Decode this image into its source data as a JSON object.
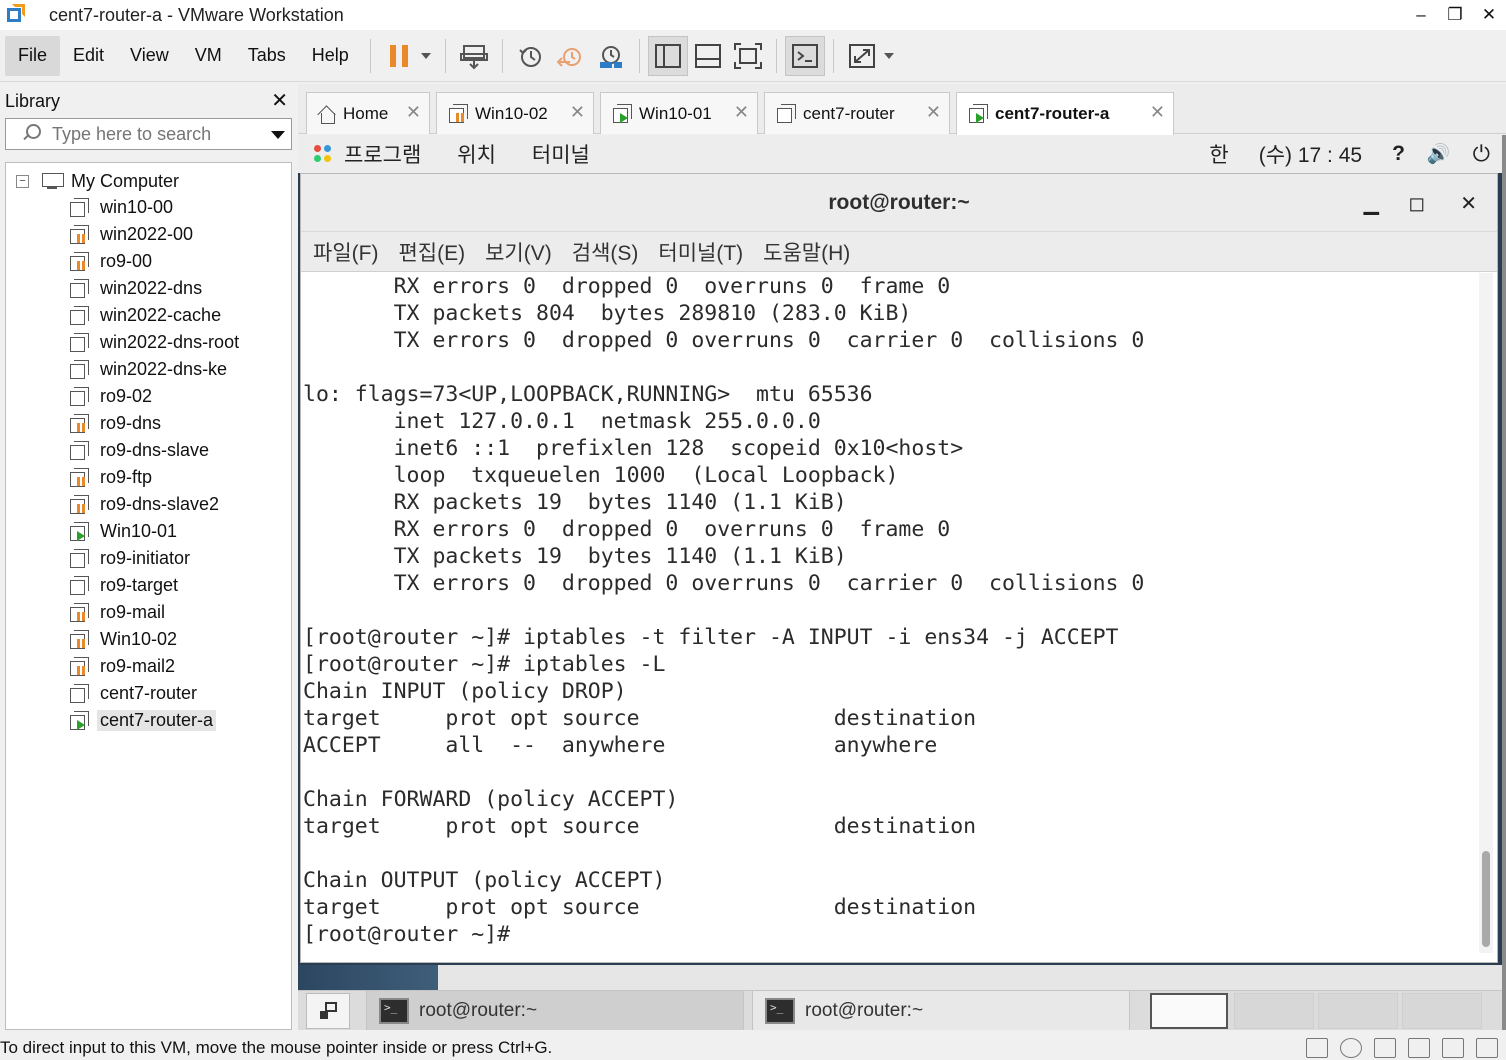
{
  "window": {
    "title": "cent7-router-a - VMware Workstation",
    "minimize": "–",
    "maximize": "❐",
    "close": "✕"
  },
  "menu": [
    "File",
    "Edit",
    "View",
    "VM",
    "Tabs",
    "Help"
  ],
  "library": {
    "title": "Library",
    "close": "✕",
    "search_placeholder": "Type here to search",
    "root": "My Computer",
    "items": [
      {
        "name": "win10-00",
        "state": "off"
      },
      {
        "name": "win2022-00",
        "state": "paused"
      },
      {
        "name": "ro9-00",
        "state": "paused"
      },
      {
        "name": "win2022-dns",
        "state": "off"
      },
      {
        "name": "win2022-cache",
        "state": "off"
      },
      {
        "name": "win2022-dns-root",
        "state": "off"
      },
      {
        "name": "win2022-dns-ke",
        "state": "off"
      },
      {
        "name": "ro9-02",
        "state": "off"
      },
      {
        "name": "ro9-dns",
        "state": "paused"
      },
      {
        "name": "ro9-dns-slave",
        "state": "off"
      },
      {
        "name": "ro9-ftp",
        "state": "paused"
      },
      {
        "name": "ro9-dns-slave2",
        "state": "paused"
      },
      {
        "name": "Win10-01",
        "state": "running"
      },
      {
        "name": "ro9-initiator",
        "state": "off"
      },
      {
        "name": "ro9-target",
        "state": "off"
      },
      {
        "name": "ro9-mail",
        "state": "paused"
      },
      {
        "name": "Win10-02",
        "state": "paused"
      },
      {
        "name": "ro9-mail2",
        "state": "paused"
      },
      {
        "name": "cent7-router",
        "state": "off"
      },
      {
        "name": "cent7-router-a",
        "state": "running",
        "selected": true
      }
    ]
  },
  "tabs": [
    {
      "label": "Home",
      "icon": "home"
    },
    {
      "label": "Win10-02",
      "icon": "paused"
    },
    {
      "label": "Win10-01",
      "icon": "running"
    },
    {
      "label": "cent7-router",
      "icon": "off"
    },
    {
      "label": "cent7-router-a",
      "icon": "running",
      "active": true
    }
  ],
  "tab_close": "✕",
  "gnome": {
    "menu": [
      "프로그램",
      "위치",
      "터미널"
    ],
    "input_method": "한",
    "clock": "(수) 17 : 45",
    "help": "?",
    "volume": "🔊",
    "power": "⏻"
  },
  "terminal": {
    "title": "root@router:~",
    "minimize": "▁",
    "maximize": "◻",
    "close": "✕",
    "menu": [
      "파일(F)",
      "편집(E)",
      "보기(V)",
      "검색(S)",
      "터미널(T)",
      "도움말(H)"
    ],
    "lines": [
      "       RX errors 0  dropped 0  overruns 0  frame 0",
      "       TX packets 804  bytes 289810 (283.0 KiB)",
      "       TX errors 0  dropped 0 overruns 0  carrier 0  collisions 0",
      "",
      "lo: flags=73<UP,LOOPBACK,RUNNING>  mtu 65536",
      "       inet 127.0.0.1  netmask 255.0.0.0",
      "       inet6 ::1  prefixlen 128  scopeid 0x10<host>",
      "       loop  txqueuelen 1000  (Local Loopback)",
      "       RX packets 19  bytes 1140 (1.1 KiB)",
      "       RX errors 0  dropped 0  overruns 0  frame 0",
      "       TX packets 19  bytes 1140 (1.1 KiB)",
      "       TX errors 0  dropped 0 overruns 0  carrier 0  collisions 0",
      "",
      "[root@router ~]# iptables -t filter -A INPUT -i ens34 -j ACCEPT",
      "[root@router ~]# iptables -L",
      "Chain INPUT (policy DROP)",
      "target     prot opt source               destination",
      "ACCEPT     all  --  anywhere             anywhere",
      "",
      "Chain FORWARD (policy ACCEPT)",
      "target     prot opt source               destination",
      "",
      "Chain OUTPUT (policy ACCEPT)",
      "target     prot opt source               destination",
      "[root@router ~]#"
    ]
  },
  "taskbar": {
    "items": [
      "root@router:~",
      "root@router:~"
    ]
  },
  "status": {
    "message": "To direct input to this VM, move the mouse pointer inside or press Ctrl+G."
  }
}
